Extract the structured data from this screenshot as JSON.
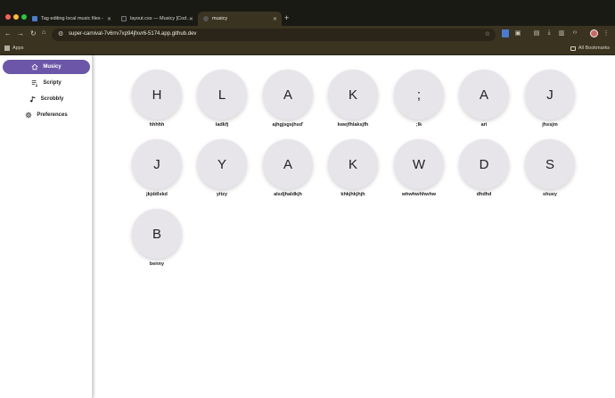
{
  "tabs": [
    {
      "title": "Tag editing local music files -",
      "active": false
    },
    {
      "title": "layout.css — Musicy [Codesp",
      "active": false
    },
    {
      "title": "musicy",
      "active": true
    }
  ],
  "toolbar": {
    "url": "super-carnival-7v6rrv7xp94jfxvr6-5174.app.github.dev"
  },
  "bookmarks": {
    "apps_label": "Apps",
    "all_label": "All Bookmarks"
  },
  "sidebar": {
    "items": [
      {
        "label": "Musicy",
        "icon": "home-icon",
        "active": true
      },
      {
        "label": "Scripty",
        "icon": "playlist-icon",
        "active": false
      },
      {
        "label": "Scrobbly",
        "icon": "music-note-icon",
        "active": false
      },
      {
        "label": "Preferences",
        "icon": "gear-icon",
        "active": false
      }
    ]
  },
  "artists": [
    {
      "initial": "H",
      "name": "hhhhh"
    },
    {
      "initial": "L",
      "name": "ladkfj"
    },
    {
      "initial": "A",
      "name": "ajhgjsgsjhsd'"
    },
    {
      "initial": "K",
      "name": "kwejfhlaksjfh"
    },
    {
      "initial": ";",
      "name": ";lk"
    },
    {
      "initial": "A",
      "name": "ari"
    },
    {
      "initial": "J",
      "name": "jhssjm"
    },
    {
      "initial": "J",
      "name": "jkjddlskd"
    },
    {
      "initial": "Y",
      "name": "yitzy"
    },
    {
      "initial": "A",
      "name": "alsdjhaldkjh"
    },
    {
      "initial": "K",
      "name": "khkjhkjhjh"
    },
    {
      "initial": "W",
      "name": "whwhwhhwhw"
    },
    {
      "initial": "D",
      "name": "dhdhd"
    },
    {
      "initial": "S",
      "name": "shuey"
    },
    {
      "initial": "B",
      "name": "benny"
    }
  ],
  "colors": {
    "accent": "#6b56a8",
    "avatar_bg": "#e7e4ea",
    "chrome_bg": "#3a3320"
  }
}
